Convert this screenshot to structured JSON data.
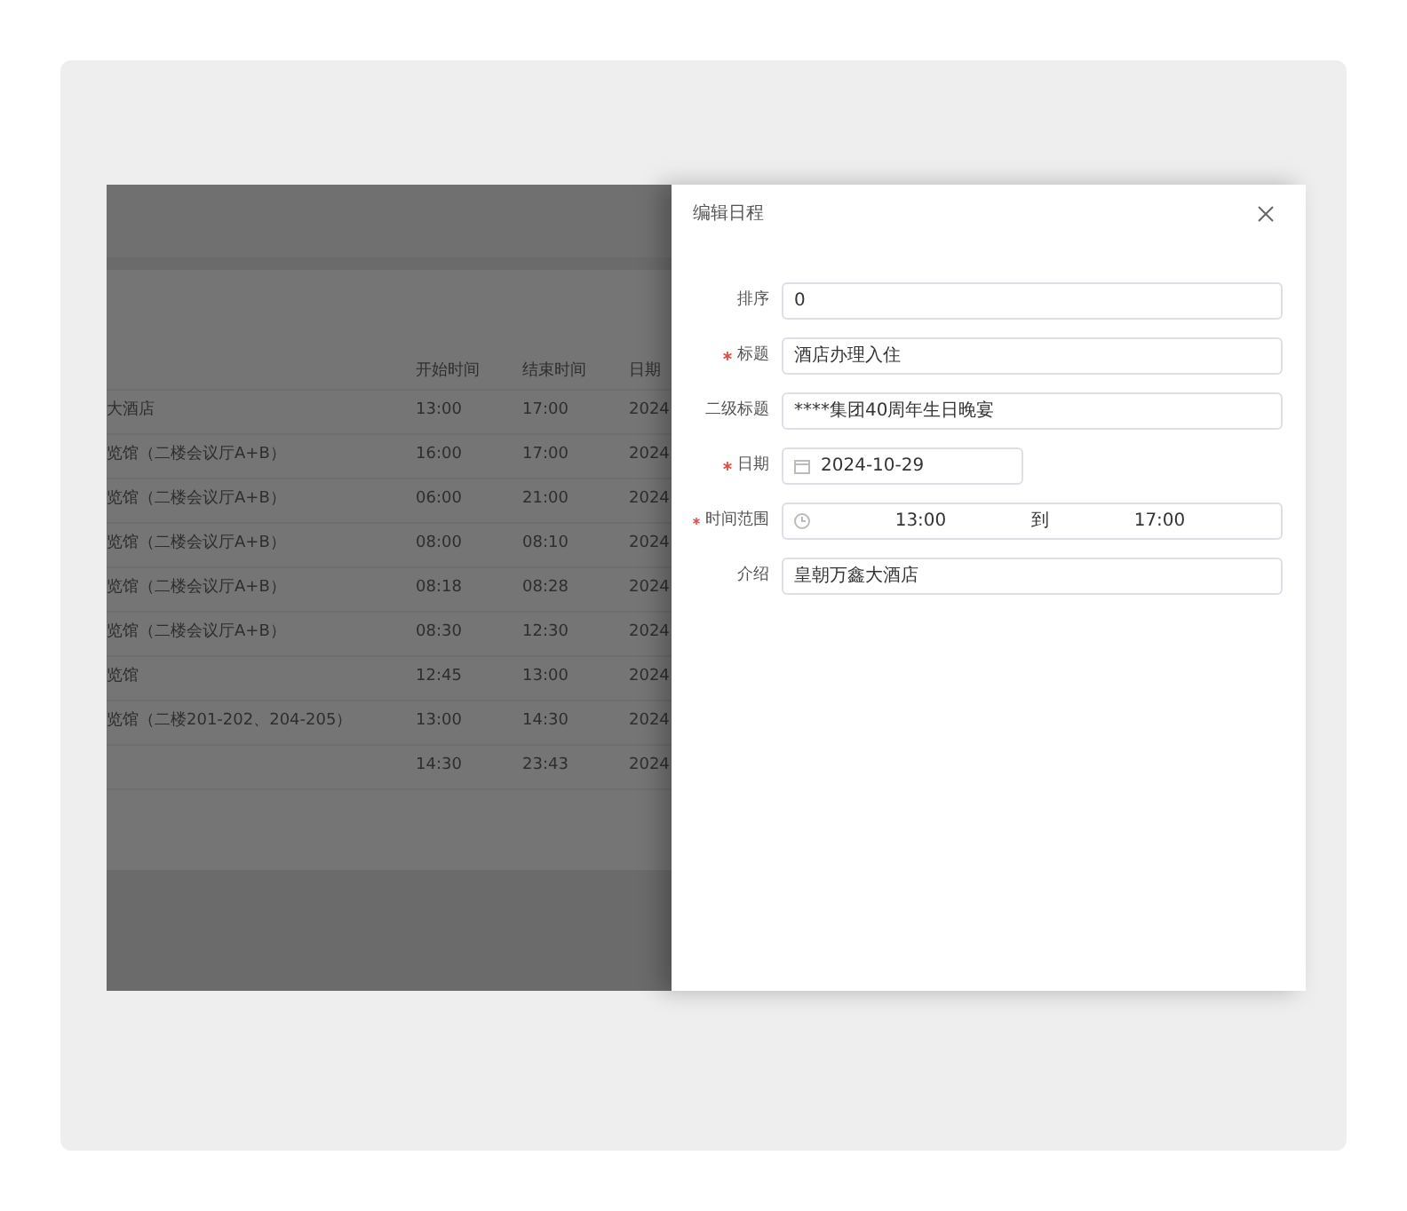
{
  "table": {
    "columns": [
      "",
      "开始时间",
      "结束时间",
      "日期"
    ],
    "rows": [
      {
        "cells": [
          "大酒店",
          "13:00",
          "17:00",
          "2024"
        ]
      },
      {
        "cells": [
          "览馆（二楼会议厅A+B）",
          "16:00",
          "17:00",
          "2024"
        ]
      },
      {
        "cells": [
          "览馆（二楼会议厅A+B）",
          "06:00",
          "21:00",
          "2024"
        ]
      },
      {
        "cells": [
          "览馆（二楼会议厅A+B）",
          "08:00",
          "08:10",
          "2024"
        ]
      },
      {
        "cells": [
          "览馆（二楼会议厅A+B）",
          "08:18",
          "08:28",
          "2024"
        ]
      },
      {
        "cells": [
          "览馆（二楼会议厅A+B）",
          "08:30",
          "12:30",
          "2024"
        ]
      },
      {
        "cells": [
          "览馆",
          "12:45",
          "13:00",
          "2024"
        ]
      },
      {
        "cells": [
          "览馆（二楼201-202、204-205）",
          "13:00",
          "14:30",
          "2024"
        ]
      },
      {
        "cells": [
          "",
          "14:30",
          "23:43",
          "2024"
        ]
      }
    ]
  },
  "drawer": {
    "title": "编辑日程",
    "fields": [
      {
        "kind": "text",
        "label": "排序",
        "required": false,
        "value": "0"
      },
      {
        "kind": "text",
        "label": "标题",
        "required": true,
        "value": "酒店办理入住"
      },
      {
        "kind": "text",
        "label": "二级标题",
        "required": false,
        "value": "****集团40周年生日晚宴"
      },
      {
        "kind": "date",
        "label": "日期",
        "required": true,
        "value": "2024-10-29"
      },
      {
        "kind": "range",
        "label": "时间范围",
        "required": true,
        "start": "13:00",
        "separator": "到",
        "end": "17:00"
      },
      {
        "kind": "text",
        "label": "介绍",
        "required": false,
        "value": "皇朝万鑫大酒店"
      }
    ]
  }
}
